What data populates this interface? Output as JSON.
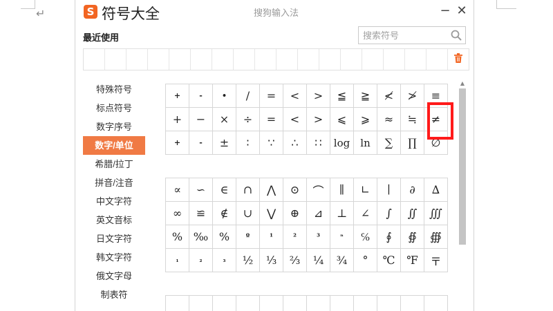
{
  "window": {
    "title": "符号大全",
    "logo_text": "S",
    "ime_name": "搜狗输入法",
    "minimize_label": "−",
    "close_label": "✕",
    "brand_color": "#f26522"
  },
  "background": {
    "return_mark": "↵"
  },
  "recent": {
    "label": "最近使用",
    "slot_count": 18
  },
  "search": {
    "placeholder": "搜索符号",
    "value": ""
  },
  "sidebar": {
    "accent_color": "#f07a44",
    "items": [
      {
        "label": "特殊符号",
        "active": false
      },
      {
        "label": "标点符号",
        "active": false
      },
      {
        "label": "数字序号",
        "active": false
      },
      {
        "label": "数字/单位",
        "active": true
      },
      {
        "label": "希腊/拉丁",
        "active": false
      },
      {
        "label": "拼音/注音",
        "active": false
      },
      {
        "label": "中文字符",
        "active": false
      },
      {
        "label": "英文音标",
        "active": false
      },
      {
        "label": "日文字符",
        "active": false
      },
      {
        "label": "韩文字符",
        "active": false
      },
      {
        "label": "俄文字母",
        "active": false
      },
      {
        "label": "制表符",
        "active": false
      }
    ]
  },
  "symbols": {
    "group1": [
      [
        "+",
        "-",
        "•",
        "∕",
        "=",
        "<",
        ">",
        "≦",
        "≧",
        "≮",
        "≯",
        "≡"
      ],
      [
        "+",
        "−",
        "×",
        "÷",
        "=",
        "<",
        ">",
        "⩽",
        "⩾",
        "≈",
        "≒",
        "≠"
      ],
      [
        "+",
        "-",
        "±",
        "∶",
        "∵",
        "∴",
        "∷",
        "log",
        "ln",
        "∑",
        "∏",
        "∅"
      ]
    ],
    "group2": [
      [
        "∝",
        "∽",
        "∈",
        "∩",
        "⋀",
        "⊙",
        "⌒",
        "∥",
        "∟",
        "∣",
        "∂",
        "∆"
      ],
      [
        "∞",
        "≌",
        "∉",
        "∪",
        "⋁",
        "⊕",
        "⊿",
        "⊥",
        "∠",
        "∫",
        "∬",
        "∭"
      ],
      [
        "%",
        "‰",
        "%",
        "º",
        "¹",
        "²",
        "³",
        "ⁿ",
        "℅",
        "∮",
        "∯",
        "∰"
      ],
      [
        "₁",
        "₂",
        "₃",
        "½",
        "⅓",
        "⅔",
        "¼",
        "¾",
        "°",
        "℃",
        "℉",
        "〒"
      ]
    ],
    "group3": [
      [
        "",
        "",
        "",
        "",
        "",
        "",
        "",
        "",
        "",
        "",
        "",
        ""
      ]
    ],
    "highlighted": "⩾",
    "highlight_color": "#ff1a1a"
  }
}
